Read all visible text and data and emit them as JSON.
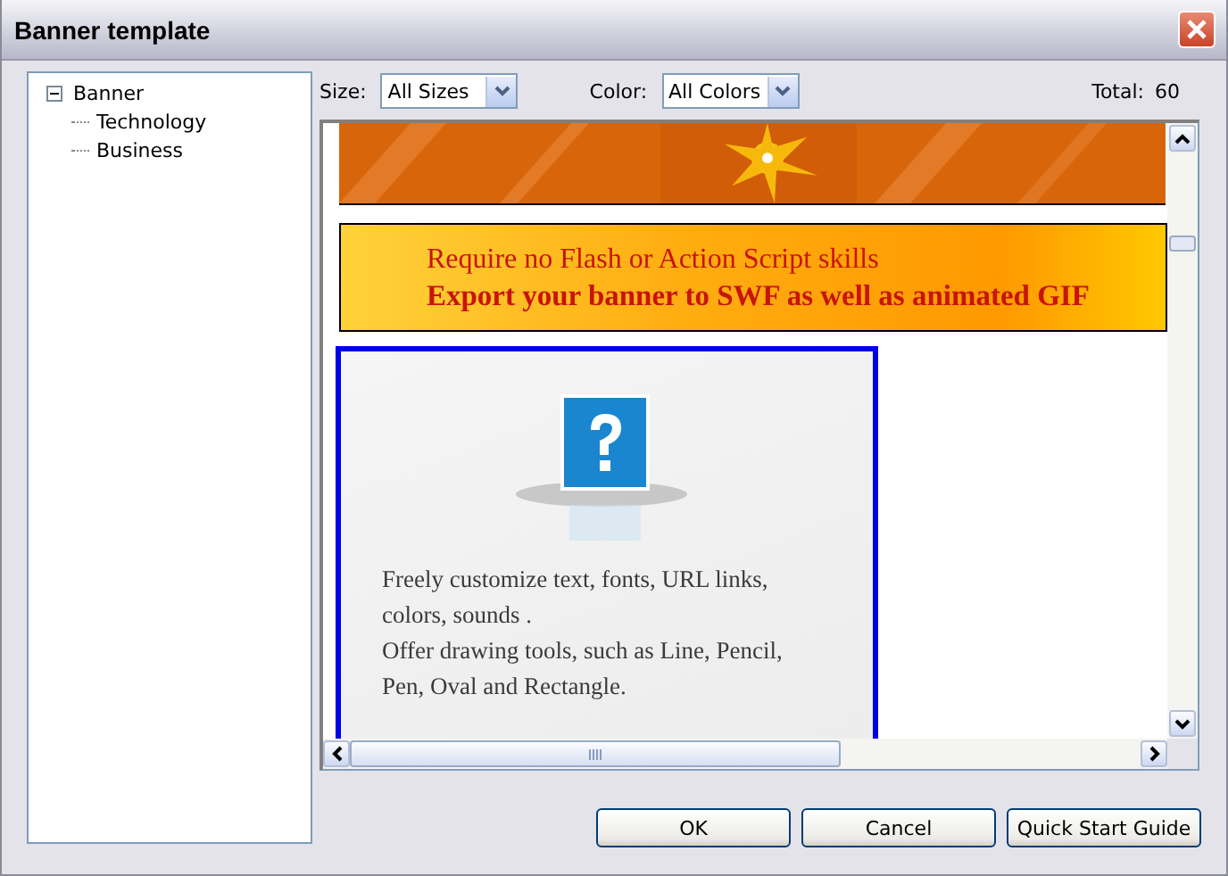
{
  "window": {
    "title": "Banner template"
  },
  "tree": {
    "label": "Banner",
    "expanded": true,
    "children": [
      {
        "label": "Technology"
      },
      {
        "label": "Business"
      }
    ]
  },
  "filters": [
    {
      "label": "Size:",
      "value": "All Sizes"
    },
    {
      "label": "Color:",
      "value": "All Colors"
    }
  ],
  "total": {
    "label": "Total:",
    "value": "60"
  },
  "templates": [
    {
      "kind": "picture",
      "selected": false
    },
    {
      "kind": "text-banner",
      "selected": false,
      "lines": [
        "Require no Flash or Action Script skills",
        "Export your banner to SWF as well as animated GIF"
      ]
    },
    {
      "kind": "feature-card",
      "selected": true,
      "lines": [
        "Freely customize text, fonts, URL links, colors, sounds .",
        "Offer drawing tools, such as Line, Pencil, Pen, Oval and Rectangle."
      ]
    }
  ],
  "buttons": [
    "OK",
    "Cancel",
    "Quick Start Guide"
  ]
}
